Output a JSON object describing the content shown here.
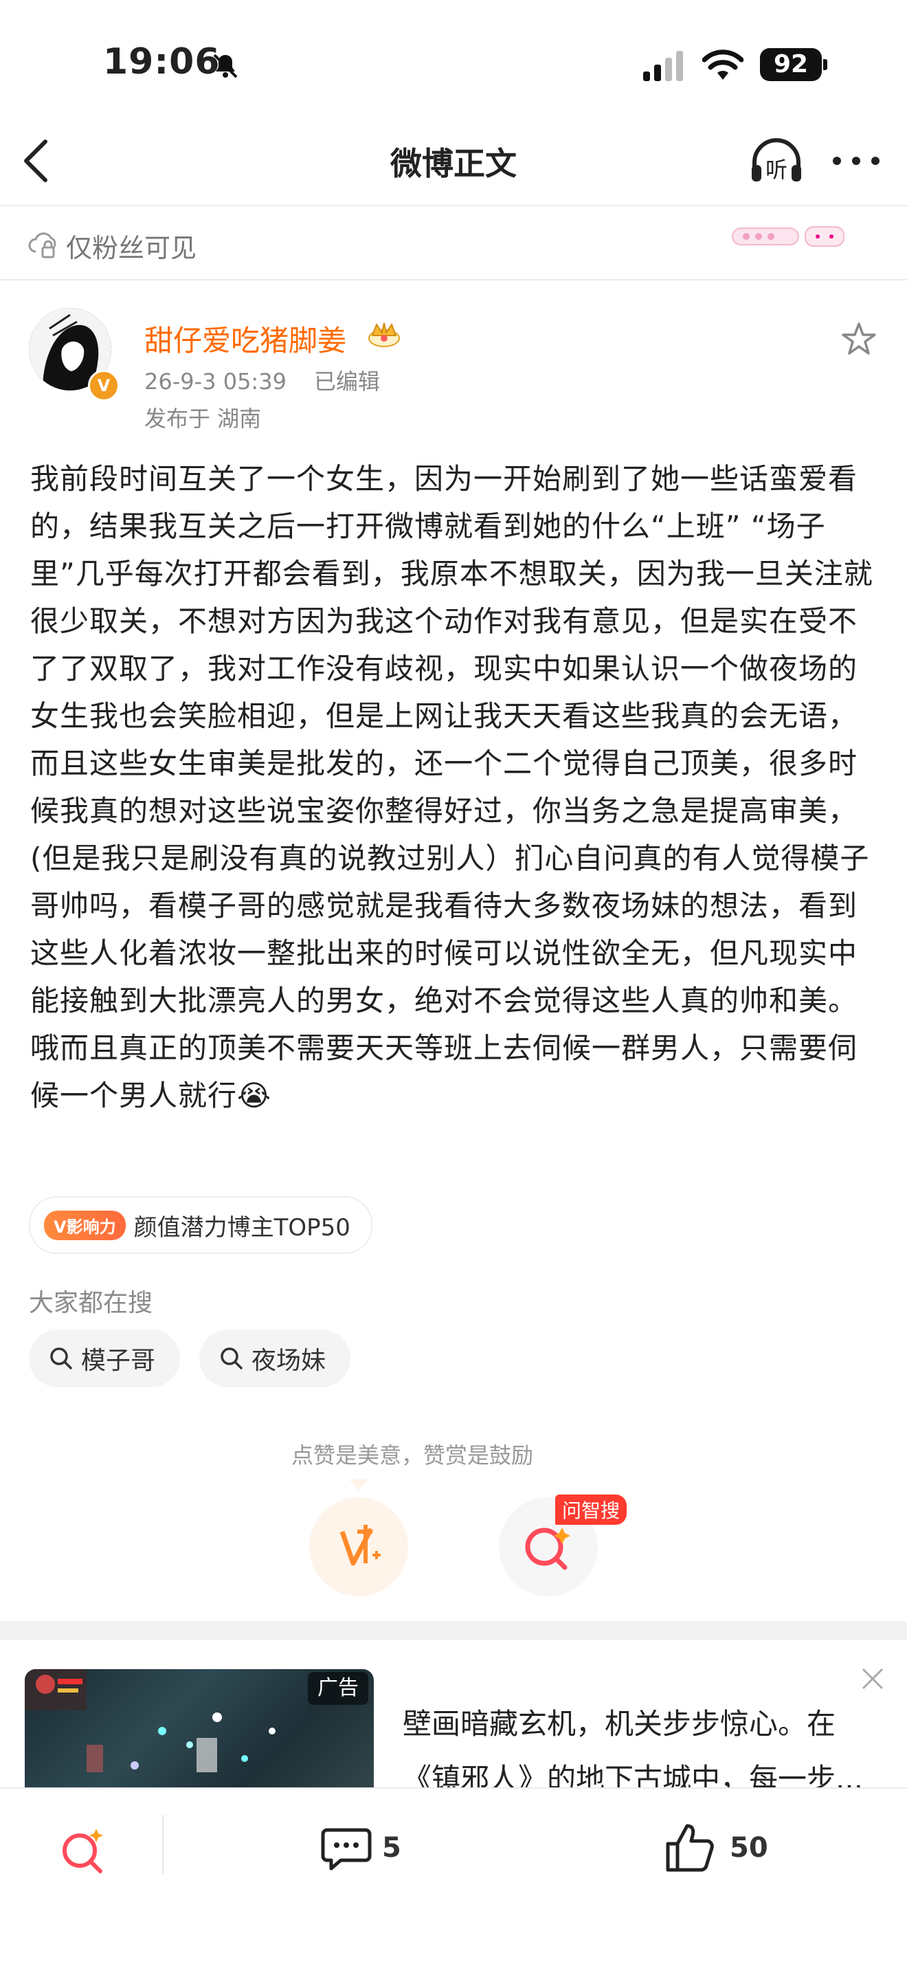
{
  "status_bar": {
    "time": "19:06",
    "battery": "92"
  },
  "nav": {
    "title": "微博正文",
    "listen_label": "听"
  },
  "visibility": {
    "label": "仅粉丝可见"
  },
  "author": {
    "name": "甜仔爱吃猪脚姜",
    "verified_badge": "V",
    "time": "26-9-3 05:39",
    "edited": "已编辑",
    "location": "发布于 湖南"
  },
  "post": {
    "text": "我前段时间互关了一个女生，因为一开始刷到了她一些话蛮爱看的，结果我互关之后一打开微博就看到她的什么“上班” “场子里”几乎每次打开都会看到，我原本不想取关，因为我一旦关注就很少取关，不想对方因为我这个动作对我有意见，但是实在受不了了双取了，我对工作没有歧视，现实中如果认识一个做夜场的女生我也会笑脸相迎，但是上网让我天天看这些我真的会无语，而且这些女生审美是批发的，还一个二个觉得自己顶美，很多时候我真的想对这些说宝姿你整得好过，你当务之急是提高审美，(但是我只是刷没有真的说教过别人）扪心自问真的有人觉得模子哥帅吗，看模子哥的感觉就是我看待大多数夜场妹的想法，看到这些人化着浓妆一整批出来的时候可以说性欲全无，但凡现实中能接触到大批漂亮人的男女，绝对不会觉得这些人真的帅和美。哦而且真正的顶美不需要天天等班上去伺候一群男人，只需要伺候一个男人就行😭"
  },
  "influence_tag": {
    "badge": "V影响力",
    "text": "颜值潜力博主TOP50"
  },
  "search": {
    "title": "大家都在搜",
    "chips": [
      "模子哥",
      "夜场妹"
    ]
  },
  "reward": {
    "hint": "点赞是美意，赞赏是鼓励",
    "ask_badge": "问智搜"
  },
  "ad": {
    "label": "广告",
    "text": "壁画暗藏玄机，机关步步惊心。在《镇邪人》的地下古城中，每一步..."
  },
  "bottom_bar": {
    "comments": "5",
    "likes": "50"
  },
  "colors": {
    "accent_orange": "#ff6a00",
    "verified": "#f39c1f",
    "badge_red": "#ff3b30"
  },
  "icons": [
    "back-icon",
    "headphones-icon",
    "more-icon",
    "cloud-lock-icon",
    "star-icon",
    "search-icon",
    "reward-icon",
    "ai-search-icon",
    "close-icon",
    "comment-icon",
    "like-icon"
  ]
}
